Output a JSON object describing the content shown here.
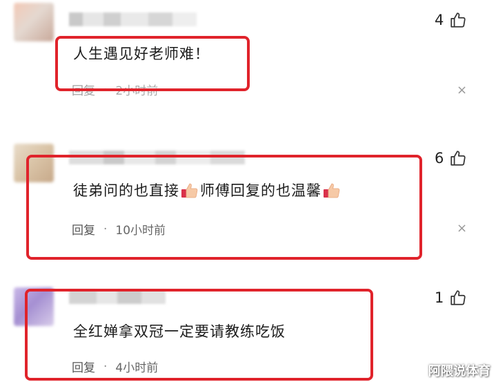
{
  "comments": [
    {
      "likes": "4",
      "text": "人生遇见好老师难！",
      "reply_label": "回复",
      "separator": "·",
      "time": "2小时前"
    },
    {
      "likes": "6",
      "text_part1": "徒弟问的也直接",
      "text_part2": "师傅回复的也温馨",
      "reply_label": "回复",
      "separator": "·",
      "time": "10小时前"
    },
    {
      "likes": "1",
      "text": "全红婵拿双冠一定要请教练吃饭",
      "reply_label": "回复",
      "separator": "·",
      "time": "4小时前"
    }
  ],
  "close_glyph": "×",
  "watermark": "阿隈说体育",
  "colors": {
    "highlight": "#e0232b"
  }
}
